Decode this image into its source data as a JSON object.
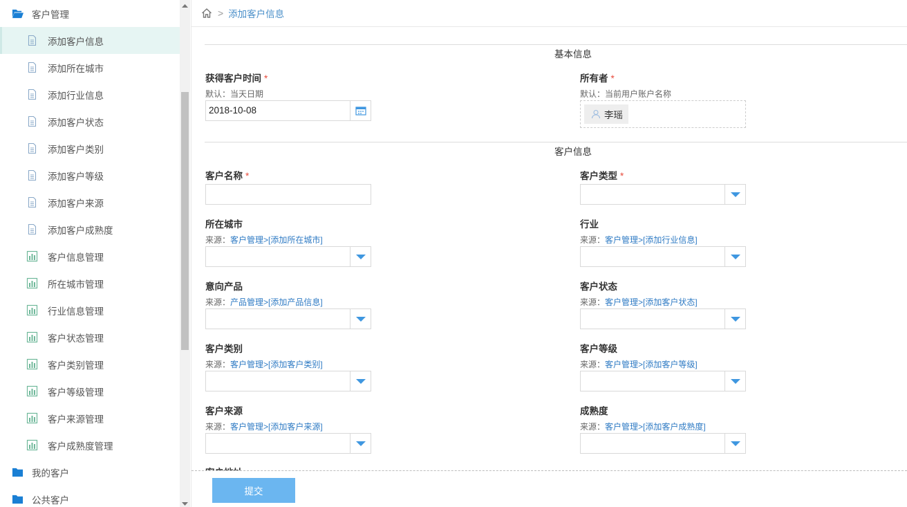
{
  "sidebar": {
    "group_customers": "客户管理",
    "items": [
      {
        "label": "添加客户信息",
        "icon": "document-icon",
        "active": true
      },
      {
        "label": "添加所在城市",
        "icon": "document-icon"
      },
      {
        "label": "添加行业信息",
        "icon": "document-icon"
      },
      {
        "label": "添加客户状态",
        "icon": "document-icon"
      },
      {
        "label": "添加客户类别",
        "icon": "document-icon"
      },
      {
        "label": "添加客户等级",
        "icon": "document-icon"
      },
      {
        "label": "添加客户来源",
        "icon": "document-icon"
      },
      {
        "label": "添加客户成熟度",
        "icon": "document-icon"
      },
      {
        "label": "客户信息管理",
        "icon": "bar-chart-icon"
      },
      {
        "label": "所在城市管理",
        "icon": "bar-chart-icon"
      },
      {
        "label": "行业信息管理",
        "icon": "bar-chart-icon"
      },
      {
        "label": "客户状态管理",
        "icon": "bar-chart-icon"
      },
      {
        "label": "客户类别管理",
        "icon": "bar-chart-icon"
      },
      {
        "label": "客户等级管理",
        "icon": "bar-chart-icon"
      },
      {
        "label": "客户来源管理",
        "icon": "bar-chart-icon"
      },
      {
        "label": "客户成熟度管理",
        "icon": "bar-chart-icon"
      }
    ],
    "group_my_customers": "我的客户",
    "group_public_customers": "公共客户"
  },
  "breadcrumb": {
    "separator": ">",
    "current": "添加客户信息"
  },
  "form": {
    "section_basic": "基本信息",
    "section_customer": "客户信息",
    "required_mark": "*",
    "acquire_time": {
      "label": "获得客户时间",
      "hint": "默认：当天日期",
      "value": "2018-10-08"
    },
    "owner": {
      "label": "所有者",
      "hint": "默认：当前用户账户名称",
      "value": "李瑶"
    },
    "customer_name": {
      "label": "客户名称"
    },
    "customer_type": {
      "label": "客户类型"
    },
    "city": {
      "label": "所在城市",
      "hint_prefix": "来源：",
      "hint_link": "客户管理>[添加所在城市]"
    },
    "industry": {
      "label": "行业",
      "hint_prefix": "来源：",
      "hint_link": "客户管理>[添加行业信息]"
    },
    "intent_product": {
      "label": "意向产品",
      "hint_prefix": "来源：",
      "hint_link": "产品管理>[添加产品信息]"
    },
    "status": {
      "label": "客户状态",
      "hint_prefix": "来源：",
      "hint_link": "客户管理>[添加客户状态]"
    },
    "category": {
      "label": "客户类别",
      "hint_prefix": "来源：",
      "hint_link": "客户管理>[添加客户类别]"
    },
    "level": {
      "label": "客户等级",
      "hint_prefix": "来源：",
      "hint_link": "客户管理>[添加客户等级]"
    },
    "source": {
      "label": "客户来源",
      "hint_prefix": "来源：",
      "hint_link": "客户管理>[添加客户来源]"
    },
    "maturity": {
      "label": "成熟度",
      "hint_prefix": "来源：",
      "hint_link": "客户管理>[添加客户成熟度]"
    },
    "address_label": "客户地址",
    "submit": "提交"
  },
  "colors": {
    "accent": "#3f97e0",
    "active_bg": "#e6f5f3",
    "required": "#e84c3d",
    "submit_bg": "#6bb6f0"
  }
}
